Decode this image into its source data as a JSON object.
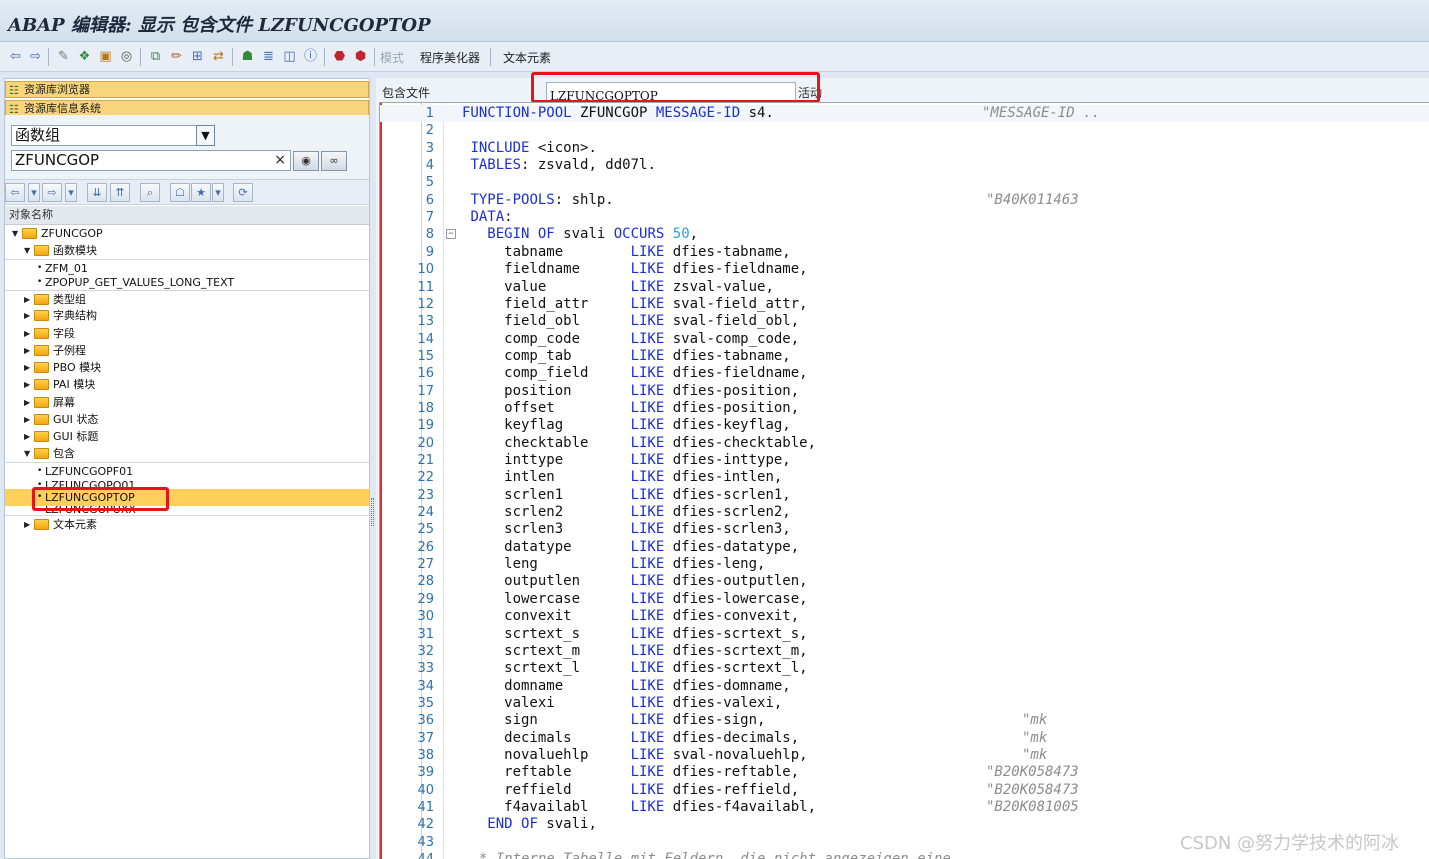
{
  "window": {
    "title": "ABAP 编辑器: 显示 包含文件 LZFUNCGOPTOP"
  },
  "toolbar": {
    "mode_label": "模式",
    "pretty_printer_label": "程序美化器",
    "text_elements_label": "文本元素"
  },
  "left": {
    "repo_browser": "资源库浏览器",
    "repo_info": "资源库信息系统",
    "object_type": "函数组",
    "object_name": "ZFUNCGOP",
    "clear_symbol": "×",
    "column_header": "对象名称",
    "tree": {
      "root": "ZFUNCGOP",
      "function_modules": "函数模块",
      "fm_items": [
        "ZFM_01",
        "ZPOPUP_GET_VALUES_LONG_TEXT"
      ],
      "folders": [
        "类型组",
        "字典结构",
        "字段",
        "子例程",
        "PBO 模块",
        "PAI 模块",
        "屏幕",
        "GUI 状态",
        "GUI 标题"
      ],
      "includes": "包含",
      "include_items": [
        "LZFUNCGOPF01",
        "LZFUNCGOPO01",
        "LZFUNCGOPTOP",
        "LZFUNCGOPUXX"
      ],
      "text_elements": "文本元素"
    }
  },
  "editor": {
    "include_label": "包含文件",
    "include_name": "LZFUNCGOPTOP",
    "status": "活动",
    "lines": [
      {
        "n": "1",
        "code": [
          [
            "kw",
            "FUNCTION-POOL"
          ],
          [
            "t",
            " ZFUNCGOP "
          ],
          [
            "kw",
            "MESSAGE-ID"
          ],
          [
            "t",
            " s4."
          ]
        ],
        "cmt": "\"MESSAGE-ID ..",
        "cmt_col": 520
      },
      {
        "n": "2",
        "code": []
      },
      {
        "n": "3",
        "code": [
          [
            "t",
            " "
          ],
          [
            "kw",
            "INCLUDE"
          ],
          [
            "t",
            " <icon>."
          ]
        ]
      },
      {
        "n": "4",
        "code": [
          [
            "t",
            " "
          ],
          [
            "kw",
            "TABLES"
          ],
          [
            "t",
            ": zsvald, dd07l."
          ]
        ]
      },
      {
        "n": "5",
        "code": []
      },
      {
        "n": "6",
        "code": [
          [
            "t",
            " "
          ],
          [
            "kw",
            "TYPE-POOLS"
          ],
          [
            "t",
            ": shlp."
          ]
        ],
        "cmt": "\"B40K011463",
        "cmt_col": 524
      },
      {
        "n": "7",
        "code": [
          [
            "t",
            " "
          ],
          [
            "kw",
            "DATA"
          ],
          [
            "t",
            ":"
          ]
        ]
      },
      {
        "n": "8",
        "code": [
          [
            "t",
            "   "
          ],
          [
            "kw",
            "BEGIN OF"
          ],
          [
            "t",
            " svali "
          ],
          [
            "kw",
            "OCCURS"
          ],
          [
            "t",
            " "
          ],
          [
            "num",
            "50"
          ],
          [
            "t",
            ","
          ]
        ],
        "fold": true
      },
      {
        "n": "9",
        "code": [
          [
            "t",
            "     tabname        "
          ],
          [
            "kw",
            "LIKE"
          ],
          [
            "t",
            " dfies-tabname,"
          ]
        ]
      },
      {
        "n": "10",
        "code": [
          [
            "t",
            "     fieldname      "
          ],
          [
            "kw",
            "LIKE"
          ],
          [
            "t",
            " dfies-fieldname,"
          ]
        ]
      },
      {
        "n": "11",
        "code": [
          [
            "t",
            "     value          "
          ],
          [
            "kw",
            "LIKE"
          ],
          [
            "t",
            " zsval-value,"
          ]
        ]
      },
      {
        "n": "12",
        "code": [
          [
            "t",
            "     field_attr     "
          ],
          [
            "kw",
            "LIKE"
          ],
          [
            "t",
            " sval-field_attr,"
          ]
        ]
      },
      {
        "n": "13",
        "code": [
          [
            "t",
            "     field_obl      "
          ],
          [
            "kw",
            "LIKE"
          ],
          [
            "t",
            " sval-field_obl,"
          ]
        ]
      },
      {
        "n": "14",
        "code": [
          [
            "t",
            "     comp_code      "
          ],
          [
            "kw",
            "LIKE"
          ],
          [
            "t",
            " sval-comp_code,"
          ]
        ]
      },
      {
        "n": "15",
        "code": [
          [
            "t",
            "     comp_tab       "
          ],
          [
            "kw",
            "LIKE"
          ],
          [
            "t",
            " dfies-tabname,"
          ]
        ]
      },
      {
        "n": "16",
        "code": [
          [
            "t",
            "     comp_field     "
          ],
          [
            "kw",
            "LIKE"
          ],
          [
            "t",
            " dfies-fieldname,"
          ]
        ]
      },
      {
        "n": "17",
        "code": [
          [
            "t",
            "     position       "
          ],
          [
            "kw",
            "LIKE"
          ],
          [
            "t",
            " dfies-position,"
          ]
        ]
      },
      {
        "n": "18",
        "code": [
          [
            "t",
            "     offset         "
          ],
          [
            "kw",
            "LIKE"
          ],
          [
            "t",
            " dfies-position,"
          ]
        ]
      },
      {
        "n": "19",
        "code": [
          [
            "t",
            "     keyflag        "
          ],
          [
            "kw",
            "LIKE"
          ],
          [
            "t",
            " dfies-keyflag,"
          ]
        ]
      },
      {
        "n": "20",
        "code": [
          [
            "t",
            "     checktable     "
          ],
          [
            "kw",
            "LIKE"
          ],
          [
            "t",
            " dfies-checktable,"
          ]
        ]
      },
      {
        "n": "21",
        "code": [
          [
            "t",
            "     inttype        "
          ],
          [
            "kw",
            "LIKE"
          ],
          [
            "t",
            " dfies-inttype,"
          ]
        ]
      },
      {
        "n": "22",
        "code": [
          [
            "t",
            "     intlen         "
          ],
          [
            "kw",
            "LIKE"
          ],
          [
            "t",
            " dfies-intlen,"
          ]
        ]
      },
      {
        "n": "23",
        "code": [
          [
            "t",
            "     scrlen1        "
          ],
          [
            "kw",
            "LIKE"
          ],
          [
            "t",
            " dfies-scrlen1,"
          ]
        ]
      },
      {
        "n": "24",
        "code": [
          [
            "t",
            "     scrlen2        "
          ],
          [
            "kw",
            "LIKE"
          ],
          [
            "t",
            " dfies-scrlen2,"
          ]
        ]
      },
      {
        "n": "25",
        "code": [
          [
            "t",
            "     scrlen3        "
          ],
          [
            "kw",
            "LIKE"
          ],
          [
            "t",
            " dfies-scrlen3,"
          ]
        ]
      },
      {
        "n": "26",
        "code": [
          [
            "t",
            "     datatype       "
          ],
          [
            "kw",
            "LIKE"
          ],
          [
            "t",
            " dfies-datatype,"
          ]
        ]
      },
      {
        "n": "27",
        "code": [
          [
            "t",
            "     leng           "
          ],
          [
            "kw",
            "LIKE"
          ],
          [
            "t",
            " dfies-leng,"
          ]
        ]
      },
      {
        "n": "28",
        "code": [
          [
            "t",
            "     outputlen      "
          ],
          [
            "kw",
            "LIKE"
          ],
          [
            "t",
            " dfies-outputlen,"
          ]
        ]
      },
      {
        "n": "29",
        "code": [
          [
            "t",
            "     lowercase      "
          ],
          [
            "kw",
            "LIKE"
          ],
          [
            "t",
            " dfies-lowercase,"
          ]
        ]
      },
      {
        "n": "30",
        "code": [
          [
            "t",
            "     convexit       "
          ],
          [
            "kw",
            "LIKE"
          ],
          [
            "t",
            " dfies-convexit,"
          ]
        ]
      },
      {
        "n": "31",
        "code": [
          [
            "t",
            "     scrtext_s      "
          ],
          [
            "kw",
            "LIKE"
          ],
          [
            "t",
            " dfies-scrtext_s,"
          ]
        ]
      },
      {
        "n": "32",
        "code": [
          [
            "t",
            "     scrtext_m      "
          ],
          [
            "kw",
            "LIKE"
          ],
          [
            "t",
            " dfies-scrtext_m,"
          ]
        ]
      },
      {
        "n": "33",
        "code": [
          [
            "t",
            "     scrtext_l      "
          ],
          [
            "kw",
            "LIKE"
          ],
          [
            "t",
            " dfies-scrtext_l,"
          ]
        ]
      },
      {
        "n": "34",
        "code": [
          [
            "t",
            "     domname        "
          ],
          [
            "kw",
            "LIKE"
          ],
          [
            "t",
            " dfies-domname,"
          ]
        ]
      },
      {
        "n": "35",
        "code": [
          [
            "t",
            "     valexi         "
          ],
          [
            "kw",
            "LIKE"
          ],
          [
            "t",
            " dfies-valexi,"
          ]
        ]
      },
      {
        "n": "36",
        "code": [
          [
            "t",
            "     sign           "
          ],
          [
            "kw",
            "LIKE"
          ],
          [
            "t",
            " dfies-sign,"
          ]
        ],
        "cmt": "\"mk",
        "cmt_col": 560
      },
      {
        "n": "37",
        "code": [
          [
            "t",
            "     decimals       "
          ],
          [
            "kw",
            "LIKE"
          ],
          [
            "t",
            " dfies-decimals,"
          ]
        ],
        "cmt": "\"mk",
        "cmt_col": 560
      },
      {
        "n": "38",
        "code": [
          [
            "t",
            "     novaluehlp     "
          ],
          [
            "kw",
            "LIKE"
          ],
          [
            "t",
            " sval-novaluehlp,"
          ]
        ],
        "cmt": "\"mk",
        "cmt_col": 560
      },
      {
        "n": "39",
        "code": [
          [
            "t",
            "     reftable       "
          ],
          [
            "kw",
            "LIKE"
          ],
          [
            "t",
            " dfies-reftable,"
          ]
        ],
        "cmt": "\"B20K058473",
        "cmt_col": 524
      },
      {
        "n": "40",
        "code": [
          [
            "t",
            "     reffield       "
          ],
          [
            "kw",
            "LIKE"
          ],
          [
            "t",
            " dfies-reffield,"
          ]
        ],
        "cmt": "\"B20K058473",
        "cmt_col": 524
      },
      {
        "n": "41",
        "code": [
          [
            "t",
            "     f4availabl     "
          ],
          [
            "kw",
            "LIKE"
          ],
          [
            "t",
            " dfies-f4availabl,"
          ]
        ],
        "cmt": "\"B20K081005",
        "cmt_col": 524
      },
      {
        "n": "42",
        "code": [
          [
            "t",
            "   "
          ],
          [
            "kw",
            "END OF"
          ],
          [
            "t",
            " svali,"
          ]
        ]
      },
      {
        "n": "43",
        "code": []
      },
      {
        "n": "44",
        "code": [
          [
            "cm",
            "  * Interne Tabelle mit Feldern, die nicht angezeigen eine"
          ]
        ]
      }
    ]
  },
  "watermark": "CSDN @努力学技术的阿冰",
  "colors": {
    "keyword": "#1a2fd6",
    "number": "#2aa0d8",
    "comment": "#8c8c8c",
    "highlight": "#ffcf5c",
    "annotation": "#e4141a"
  }
}
